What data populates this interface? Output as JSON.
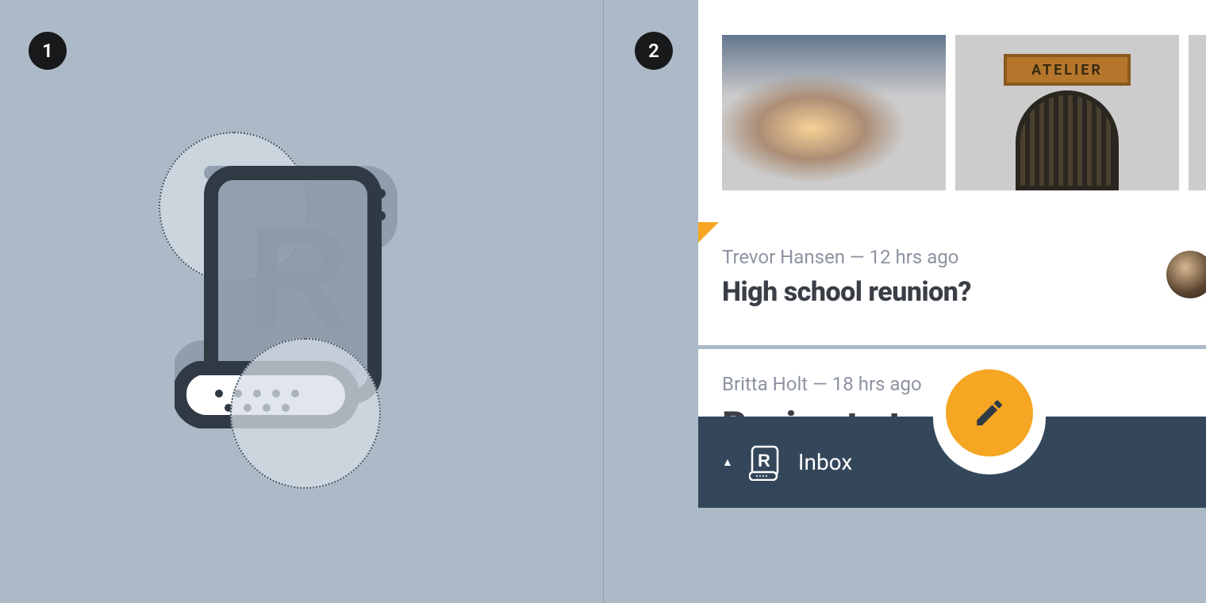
{
  "steps": {
    "one": "1",
    "two": "2"
  },
  "logo_letter": "R",
  "gallery": {
    "sign_text": "ATELIER"
  },
  "cards": [
    {
      "author": "Trevor Hansen",
      "sep": " — ",
      "time": "12 hrs ago",
      "subject": "High school reunion?"
    },
    {
      "author": "Britta Holt",
      "sep": " — ",
      "time": "18 hrs ago",
      "subject": "Recipe to try"
    }
  ],
  "bottom_bar": {
    "label": "Inbox"
  }
}
